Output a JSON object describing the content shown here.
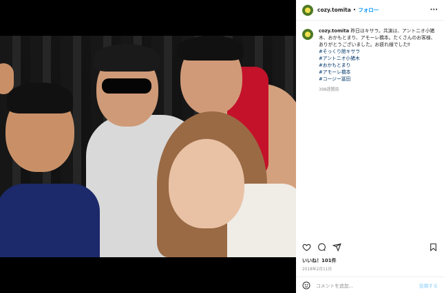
{
  "post": {
    "username": "cozy.tomita",
    "separator": "•",
    "follow_label": "フォロー",
    "more_label": "···",
    "caption": "昨日はキサラ。共演は、アントニオ小猪木、おかもとまり、アモーレ橋本。たくさんのお客様、ありがとうございました。お疲れ様でした‼︎",
    "hashtags": [
      "#そっくり館キサラ",
      "#アントニオ小猪木",
      "#おかもとまり",
      "#アモーレ橋本",
      "#コージー冨田"
    ],
    "time_ago": "398週間前",
    "likes": "いいね！101件",
    "date": "2018年2月11日",
    "comment_placeholder": "コメントを追加...",
    "post_label": "投稿する"
  },
  "icons": {
    "like": "heart-icon",
    "comment": "comment-icon",
    "share": "share-icon",
    "save": "bookmark-icon",
    "emoji": "emoji-icon"
  },
  "colors": {
    "link_blue": "#0095f6",
    "hashtag": "#00376b",
    "muted": "#8e8e8e",
    "post_disabled": "#b2dffc"
  }
}
